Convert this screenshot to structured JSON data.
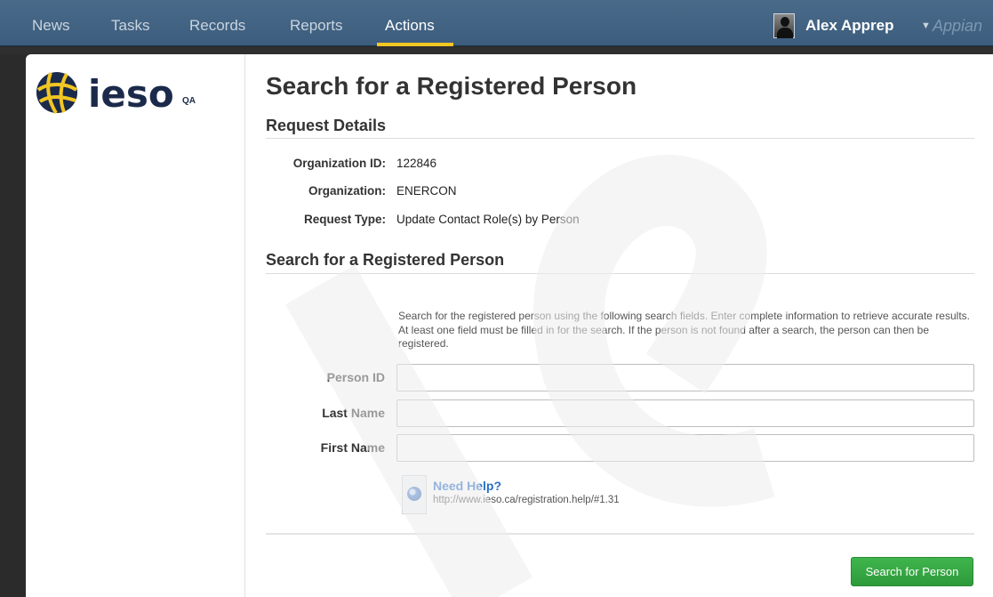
{
  "nav": {
    "items": [
      {
        "label": "News",
        "active": false
      },
      {
        "label": "Tasks",
        "active": false
      },
      {
        "label": "Records",
        "active": false
      },
      {
        "label": "Reports",
        "active": false
      },
      {
        "label": "Actions",
        "active": true
      }
    ],
    "user_name": "Alex Apprep",
    "user_caret_icon": "caret-down-icon",
    "brand": "Appian",
    "active_underline_color": "#f2c623"
  },
  "sidebar": {
    "logo_text": "ieso",
    "environment_badge": "QA"
  },
  "page": {
    "title": "Search for a Registered Person",
    "request_details": {
      "header": "Request Details",
      "rows": [
        {
          "label": "Organization ID:",
          "value": "122846"
        },
        {
          "label": "Organization:",
          "value": "ENERCON"
        },
        {
          "label": "Request Type:",
          "value": "Update Contact Role(s) by Person"
        }
      ]
    },
    "search": {
      "header": "Search for a Registered Person",
      "instructions": "Search for the registered person using the following search fields. Enter complete information to retrieve accurate results. At least one field must be filled in for the search. If the person is not found after a search, the person can then be registered.",
      "fields": [
        {
          "label": "Person ID",
          "value": ""
        },
        {
          "label": "Last Name",
          "value": ""
        },
        {
          "label": "First Name",
          "value": ""
        }
      ]
    },
    "help": {
      "title": "Need Help?",
      "url": "http://www.ieso.ca/registration.help/#1.31",
      "icon": "globe-icon"
    },
    "submit_label": "Search for Person",
    "submit_color": "#33a443"
  }
}
